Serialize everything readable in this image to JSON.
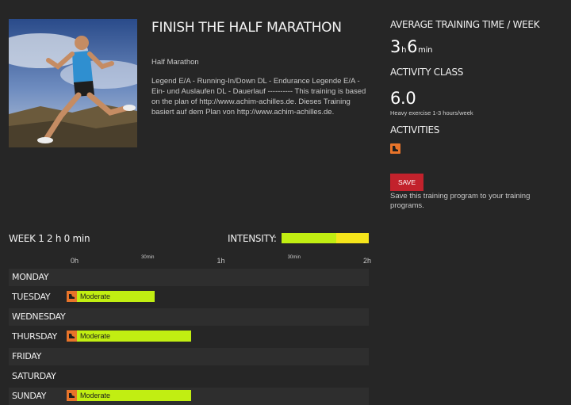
{
  "plan": {
    "title": "FINISH THE HALF MARATHON",
    "subtitle": "Half Marathon",
    "description": "Legend E/A - Running-In/Down DL - Endurance Legende E/A - Ein- und Auslaufen DL - Dauerlauf ---------- This training is based on the plan of http://www.achim-achilles.de. Dieses Training basiert auf dem Plan von http://www.achim-achilles.de.",
    "photo_icon": "runner-photo"
  },
  "side": {
    "avg_heading": "AVERAGE TRAINING TIME / WEEK",
    "avg_hours": "3",
    "avg_h_unit": "h",
    "avg_minutes": "6",
    "avg_min_unit": "min",
    "class_heading": "ACTIVITY CLASS",
    "class_value": "6.0",
    "class_desc": "Heavy exercise 1-3 hours/week",
    "activities_heading": "ACTIVITIES",
    "activity_icon": "running-shoe-icon",
    "save_label": "SAVE",
    "save_desc": "Save this training program to your training programs."
  },
  "week": {
    "label": "WEEK 1",
    "duration": "2 h 0 min",
    "intensity_label": "INTENSITY:",
    "intensity": [
      {
        "color": "#c1ee12",
        "fraction": 0.63
      },
      {
        "color": "#f5e51b",
        "fraction": 0.37
      }
    ],
    "ticks": [
      {
        "label": "0h",
        "size": "big",
        "hours": 0
      },
      {
        "label": "30min",
        "size": "small",
        "hours": 0.5
      },
      {
        "label": "1h",
        "size": "big",
        "hours": 1
      },
      {
        "label": "30min",
        "size": "small",
        "hours": 1.5
      },
      {
        "label": "2h",
        "size": "big",
        "hours": 2
      }
    ],
    "days": [
      {
        "name": "MONDAY"
      },
      {
        "name": "TUESDAY",
        "session": {
          "label": "Moderate",
          "hours": 0.6
        }
      },
      {
        "name": "WEDNESDAY"
      },
      {
        "name": "THURSDAY",
        "session": {
          "label": "Moderate",
          "hours": 0.85
        }
      },
      {
        "name": "FRIDAY"
      },
      {
        "name": "SATURDAY"
      },
      {
        "name": "SUNDAY",
        "session": {
          "label": "Moderate",
          "hours": 0.85
        }
      }
    ]
  },
  "colors": {
    "background": "#262626",
    "accent_red": "#c2222c",
    "moderate": "#c1ee12",
    "activity_orange": "#e8742a"
  }
}
